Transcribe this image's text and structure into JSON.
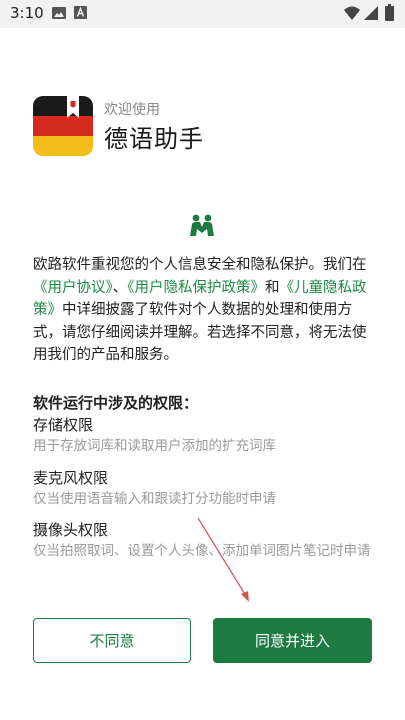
{
  "status_bar": {
    "time": "3:10",
    "icons": [
      "image-notification-icon",
      "text-a-notification-icon",
      "wifi-icon",
      "cell-signal-icon",
      "battery-icon"
    ]
  },
  "header": {
    "welcome": "欢迎使用",
    "app_name": "德语助手"
  },
  "intro": {
    "part1": "欧路软件重视您的个人信息安全和隐私保护。我们在",
    "link_user_agreement": "《用户协议》",
    "sep1": "、",
    "link_privacy_policy": "《用户隐私保护政策》",
    "sep2": "和",
    "link_child_privacy": "《儿童隐私政策》",
    "part2": "中详细披露了软件对个人数据的处理和使用方式，请您仔细阅读并理解。若选择不同意，将无法使用我们的产品和服务。"
  },
  "permissions": {
    "title": "软件运行中涉及的权限：",
    "items": [
      {
        "name": "存储权限",
        "desc": "用于存放词库和读取用户添加的扩充词库"
      },
      {
        "name": "麦克风权限",
        "desc": "仅当使用语音输入和跟读打分功能时申请"
      },
      {
        "name": "摄像头权限",
        "desc": "仅当拍照取词、设置个人头像、添加单词图片笔记时申请"
      }
    ]
  },
  "buttons": {
    "decline": "不同意",
    "accept": "同意并进入"
  },
  "colors": {
    "accent": "#1d7b42",
    "link": "#1e8a45",
    "annotation_arrow": "#d9534f"
  }
}
